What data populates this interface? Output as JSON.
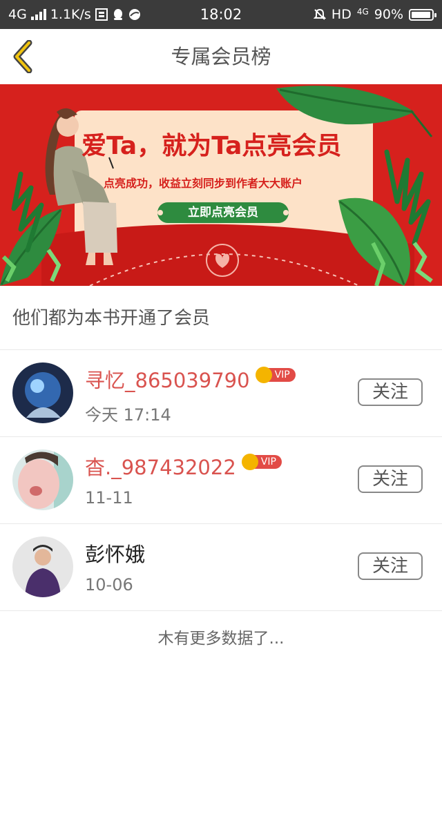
{
  "statusbar": {
    "network": "4G",
    "speed": "1.1K/s",
    "time": "18:02",
    "hd": "HD",
    "net_small": "4G",
    "battery": "90%"
  },
  "header": {
    "title": "专属会员榜"
  },
  "banner": {
    "headline": "爱Ta，就为Ta点亮会员",
    "subtitle": "点亮成功，收益立刻同步到作者大大账户",
    "button_label": "立即点亮会员"
  },
  "section": {
    "title": "他们都为本书开通了会员"
  },
  "members": [
    {
      "name": "寻忆_865039790",
      "time": "今天 17:14",
      "vip": true,
      "vip_label": "VIP",
      "follow_label": "关注"
    },
    {
      "name": "杳._987432022",
      "time": "11-11",
      "vip": true,
      "vip_label": "VIP",
      "follow_label": "关注"
    },
    {
      "name": "彭怀娥",
      "time": "10-06",
      "vip": false,
      "follow_label": "关注"
    }
  ],
  "footer": {
    "no_more": "木有更多数据了..."
  },
  "colors": {
    "accent_red": "#d9534f",
    "banner_red": "#d6211d",
    "banner_card": "#fde2c8",
    "banner_green": "#2e8b3f",
    "vip_gold": "#f4b400",
    "statusbar": "#3b3b3b"
  }
}
